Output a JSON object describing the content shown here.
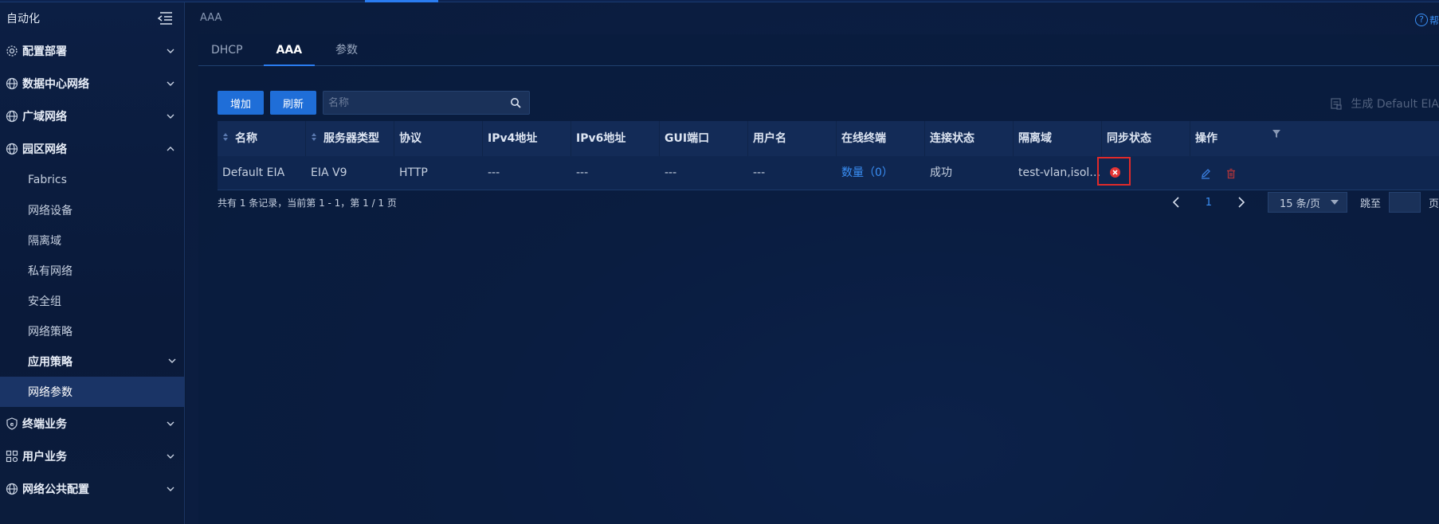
{
  "sidebar": {
    "title": "自动化",
    "items": [
      {
        "label": "配置部署",
        "icon": "gear-icon"
      },
      {
        "label": "数据中心网络",
        "icon": "globe-icon"
      },
      {
        "label": "广域网络",
        "icon": "globe-icon"
      },
      {
        "label": "园区网络",
        "icon": "globe-icon"
      }
    ],
    "campus_subitems": [
      "Fabrics",
      "网络设备",
      "隔离域",
      "私有网络",
      "安全组",
      "网络策略",
      "应用策略",
      "网络参数"
    ],
    "bottom_items": [
      {
        "label": "终端业务",
        "icon": "shield-icon"
      },
      {
        "label": "用户业务",
        "icon": "users-icon"
      },
      {
        "label": "网络公共配置",
        "icon": "globe-icon"
      }
    ]
  },
  "main": {
    "breadcrumb": "AAA",
    "help_text": "帮",
    "tabs": [
      "DHCP",
      "AAA",
      "参数"
    ],
    "active_tab": "AAA",
    "toolbar": {
      "add_label": "增加",
      "refresh_label": "刷新",
      "search_placeholder": "名称",
      "generate_label": "生成 Default EIA"
    },
    "table": {
      "columns": [
        "名称",
        "服务器类型",
        "协议",
        "IPv4地址",
        "IPv6地址",
        "GUI端口",
        "用户名",
        "在线终端",
        "连接状态",
        "隔离域",
        "同步状态",
        "操作"
      ],
      "rows": [
        {
          "name": "Default EIA",
          "server_type": "EIA V9",
          "protocol": "HTTP",
          "ipv4": "---",
          "ipv6": "---",
          "gui_port": "---",
          "username": "---",
          "online": "数量（0）",
          "conn_status": "成功",
          "isolation": "test-vlan,isolate...",
          "sync_status": "error"
        }
      ]
    },
    "pager": {
      "total": "共有 1 条记录，当前第 1 - 1，第 1 / 1 页",
      "page": "1",
      "size": "15 条/页",
      "jump": "跳至",
      "page_suffix": "页"
    }
  },
  "colors": {
    "accent": "#1f6ed8",
    "link": "#3a8ff5",
    "error": "#e53535",
    "highlight_box": "#e02a2a"
  }
}
